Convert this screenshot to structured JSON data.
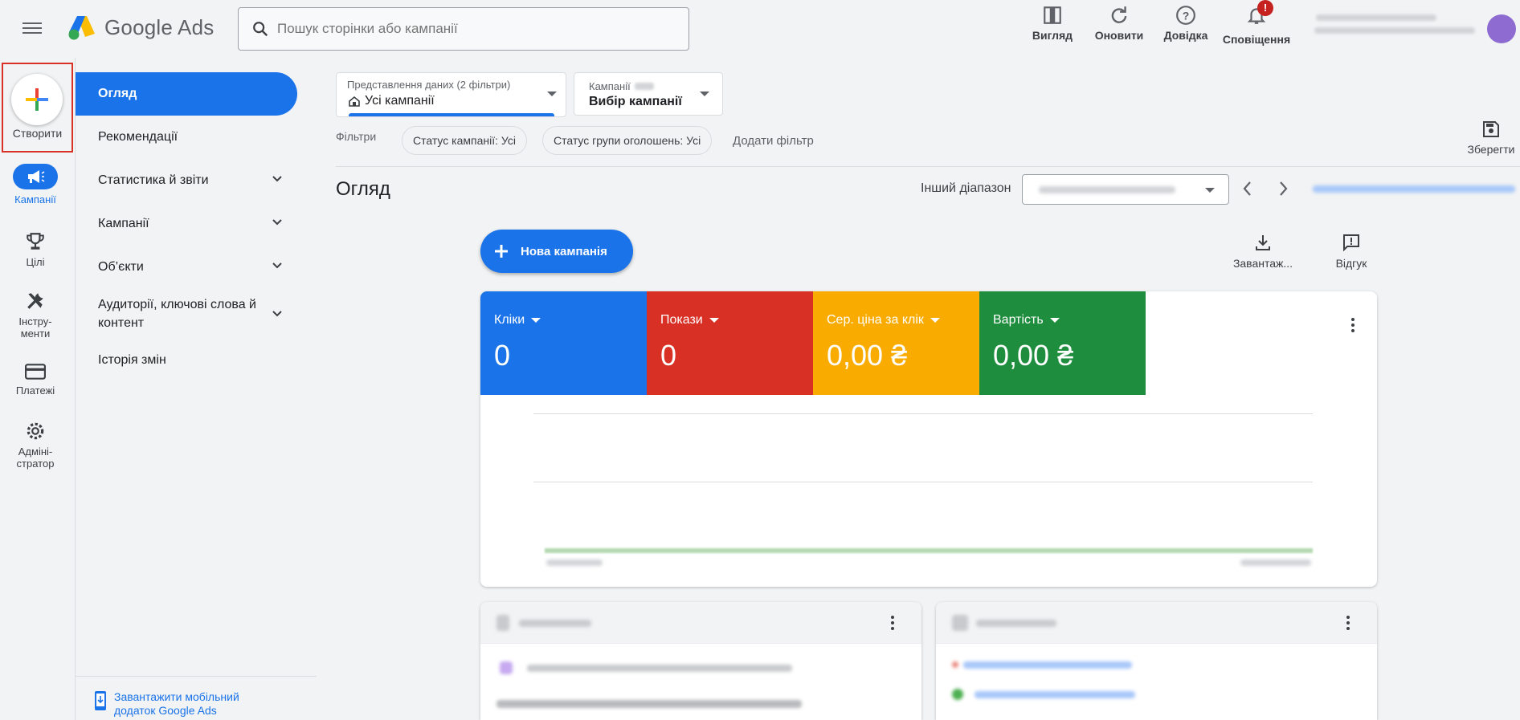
{
  "app": {
    "name": "Google Ads",
    "search_placeholder": "Пошук сторінки або кампанії"
  },
  "toolbar": {
    "view": "Вигляд",
    "refresh": "Оновити",
    "help": "Довідка",
    "notifications": "Сповіщення",
    "notifications_badge": "!"
  },
  "rail": {
    "create": "Створити",
    "items": [
      {
        "label": "Кампанії",
        "icon": "megaphone-icon",
        "active": true
      },
      {
        "label": "Цілі",
        "icon": "trophy-icon"
      },
      {
        "label": "Інстру-менти",
        "icon": "tools-icon"
      },
      {
        "label": "Платежі",
        "icon": "credit-card-icon"
      },
      {
        "label": "Адміні-стратор",
        "icon": "gear-icon"
      }
    ]
  },
  "nav": {
    "items": [
      {
        "label": "Огляд",
        "active": true
      },
      {
        "label": "Рекомендації"
      },
      {
        "label": "Статистика й звіти",
        "expandable": true
      },
      {
        "label": "Кампанії",
        "expandable": true
      },
      {
        "label": "Об’єкти",
        "expandable": true
      },
      {
        "label": "Аудиторії, ключові слова й контент",
        "expandable": true
      },
      {
        "label": "Історія змін"
      }
    ],
    "mobile_link": "Завантажити мобільний додаток Google Ads"
  },
  "filters": {
    "view_dropdown_label": "Представлення даних (2 фільтри)",
    "view_dropdown_value": "Усі кампанії",
    "campaign_dropdown_label": "Кампанії",
    "campaign_dropdown_value": "Вибір кампанії",
    "filters_label": "Фільтри",
    "chips": [
      "Статус кампанії: Усі",
      "Статус групи оголошень: Усі"
    ],
    "add_filter": "Додати фільтр",
    "save": "Зберегти"
  },
  "page": {
    "title": "Огляд",
    "range_label": "Інший діапазон"
  },
  "actions": {
    "new_campaign": "Нова кампанія",
    "download": "Завантаж...",
    "feedback": "Відгук"
  },
  "metrics": [
    {
      "name": "Кліки",
      "value": "0",
      "color": "#1a73e8"
    },
    {
      "name": "Покази",
      "value": "0",
      "color": "#d93025"
    },
    {
      "name": "Сер. ціна за клік",
      "value": "0,00 ₴",
      "color": "#f9ab00"
    },
    {
      "name": "Вартість",
      "value": "0,00 ₴",
      "color": "#1e8e3e"
    }
  ],
  "colors": {
    "accent": "#1a73e8",
    "highlight_border": "#d93025"
  }
}
